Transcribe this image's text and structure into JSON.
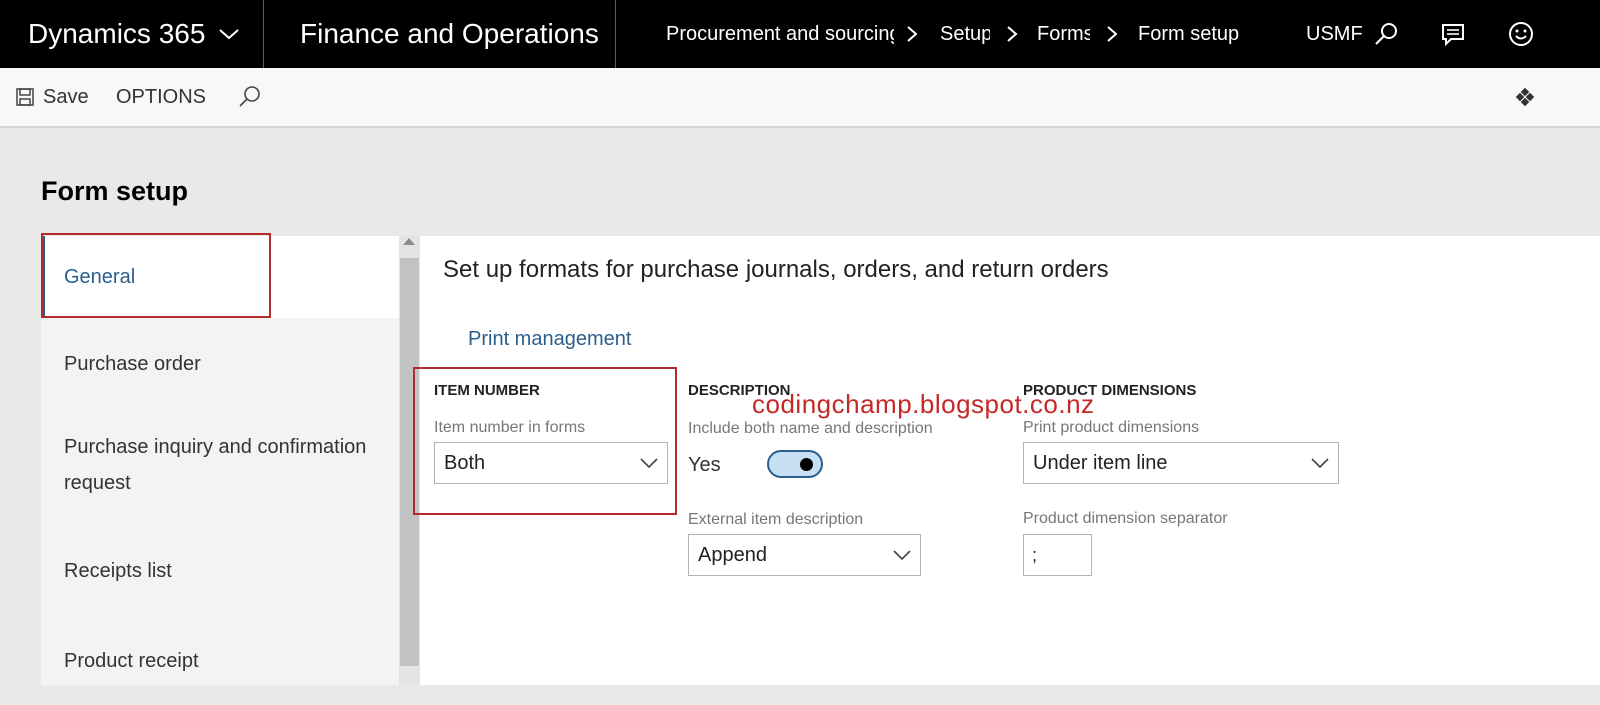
{
  "navbar": {
    "app_name": "Dynamics 365",
    "module_name": "Finance and Operations",
    "breadcrumbs": [
      "Procurement and sourcing",
      "Setup",
      "Forms",
      "Form setup"
    ],
    "company": "USMF",
    "icons": [
      "search-icon",
      "message-icon",
      "smiley-icon"
    ]
  },
  "actionbar": {
    "save_label": "Save",
    "options_label": "OPTIONS"
  },
  "page": {
    "title": "Form setup"
  },
  "leftnav": {
    "items": [
      {
        "label": "General",
        "active": true
      },
      {
        "label": "Purchase order"
      },
      {
        "label": "Purchase inquiry and confirmation request"
      },
      {
        "label": "Receipts list"
      },
      {
        "label": "Product receipt"
      }
    ]
  },
  "content": {
    "heading": "Set up formats for purchase journals, orders, and return orders",
    "print_management_link": "Print management",
    "item_number": {
      "title": "ITEM NUMBER",
      "field_label": "Item number in forms",
      "value": "Both"
    },
    "description": {
      "title": "DESCRIPTION",
      "toggle_label": "Include both name and description",
      "toggle_value": "Yes",
      "toggle_on": true,
      "external_label": "External item description",
      "external_value": "Append"
    },
    "product_dimensions": {
      "title": "PRODUCT DIMENSIONS",
      "print_label": "Print product dimensions",
      "print_value": "Under item line",
      "separator_label": "Product dimension separator",
      "separator_value": ";"
    }
  },
  "watermark": "codingchamp.blogspot.co.nz",
  "colors": {
    "navbar": "#000000",
    "accent": "#2b5e8c",
    "highlight_box": "#b52b2b",
    "watermark": "#c62828"
  }
}
